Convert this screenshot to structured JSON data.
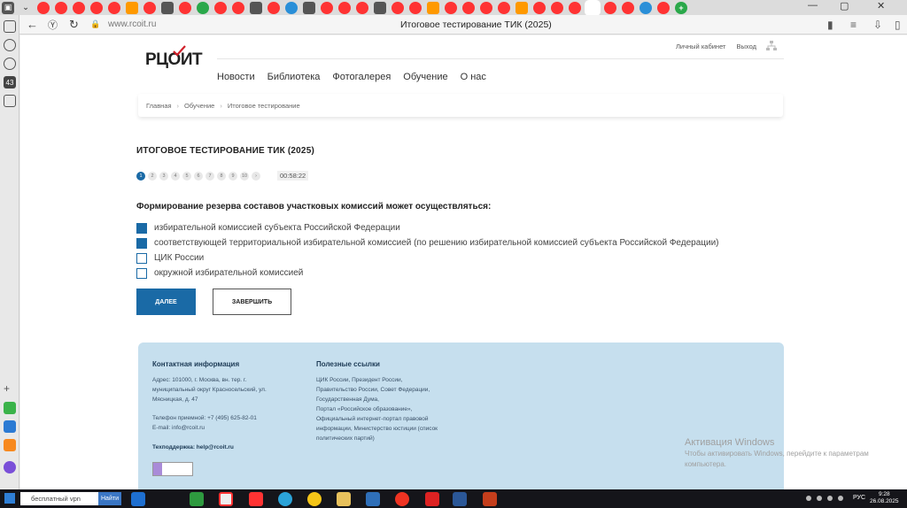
{
  "browser": {
    "url": "www.rcoit.ru",
    "page_title": "Итоговое тестирование ТИК (2025)",
    "window_close": "✕",
    "new_tab": "+"
  },
  "site": {
    "logo_text": "РЦОИТ",
    "top_links": [
      "Личный кабинет",
      "Выход"
    ],
    "nav": [
      "Новости",
      "Библиотека",
      "Фотогалерея",
      "Обучение",
      "О нас"
    ],
    "breadcrumbs": [
      "Главная",
      "Обучение",
      "Итоговое тестирование"
    ]
  },
  "test": {
    "title": "ИТОГОВОЕ ТЕСТИРОВАНИЕ ТИК (2025)",
    "pages": [
      "1",
      "2",
      "3",
      "4",
      "5",
      "6",
      "7",
      "8",
      "9",
      "10",
      "›"
    ],
    "active_page": "1",
    "timer": "00:58:22",
    "question": "Формирование резерва составов участковых комиссий может осуществляться:",
    "options": [
      {
        "label": "избирательной комиссией субъекта Российской Федерации",
        "checked": true
      },
      {
        "label": "соответствующей территориальной избирательной комиссией (по решению избирательной комиссией субъекта Российской Федерации)",
        "checked": true
      },
      {
        "label": "ЦИК России",
        "checked": false
      },
      {
        "label": "окружной избирательной комиссией",
        "checked": false
      }
    ],
    "next_label": "ДАЛЕЕ",
    "finish_label": "ЗАВЕРШИТЬ"
  },
  "footer": {
    "contact_title": "Контактная информация",
    "address_lines": [
      "Адрес: 101000, г. Москва, вн. тер. г.",
      "муниципальный округ Красносельский, ул.",
      "Мясницкая, д. 47"
    ],
    "phone": "Телефон приемной: +7 (495) 625-82-01",
    "email": "E-mail: info@rcoit.ru",
    "support": "Техподдержка: help@rcoit.ru",
    "links_title": "Полезные ссылки",
    "links_lines": [
      "ЦИК России, Президент России,",
      "Правительство России, Совет Федерации,",
      "Государственная Дума,",
      "Портал «Российское образование»,",
      "Официальный интернет-портал правовой",
      "информации, Министерство юстиции (список",
      "политических партий)"
    ]
  },
  "watermark": {
    "line1": "Активация Windows",
    "line2": "Чтобы активировать Windows, перейдите к параметрам",
    "line3": "компьютера."
  },
  "taskbar": {
    "search_placeholder": "бесплатный vpn",
    "search_button": "Найти",
    "lang": "РУС",
    "time": "9:28",
    "date": "26.08.2025"
  },
  "colors": {
    "accent": "#1a6aa6",
    "footer_bg": "#c6dfee"
  }
}
